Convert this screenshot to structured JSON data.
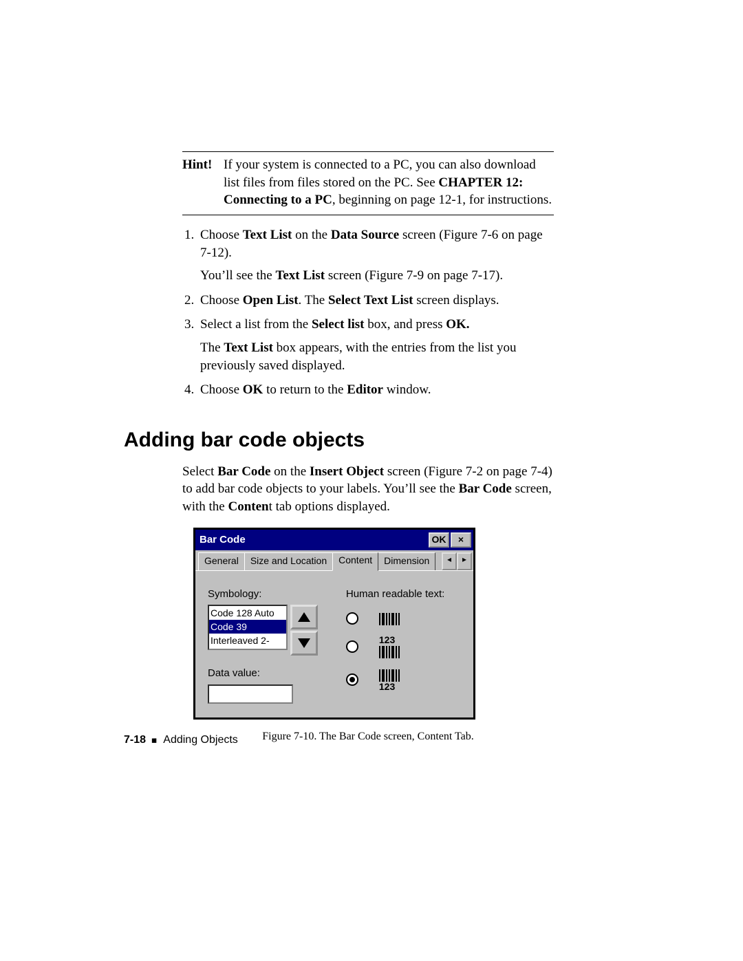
{
  "hint": {
    "label": "Hint!",
    "text_pre": "If your system is connected to a PC, you can also download list files from files stored on the PC. See ",
    "bold1": "CHAPTER 12: Connecting to a PC",
    "text_post": ", beginning on page 12-1, for instructions."
  },
  "steps": {
    "s1a": "Choose ",
    "s1b": "Text List",
    "s1c": " on the ",
    "s1d": "Data Source",
    "s1e": " screen (Figure 7-6 on page 7-12).",
    "s1p2a": "You’ll see the ",
    "s1p2b": "Text List",
    "s1p2c": " screen (Figure 7-9 on page 7-17).",
    "s2a": "Choose ",
    "s2b": "Open List",
    "s2c": ". The ",
    "s2d": "Select Text List",
    "s2e": " screen displays.",
    "s3a": "Select a list from the ",
    "s3b": "Select list",
    "s3c": " box, and press ",
    "s3d": "OK.",
    "s3p2a": "The ",
    "s3p2b": "Text List",
    "s3p2c": " box appears, with the entries from the list you previously saved displayed.",
    "s4a": "Choose ",
    "s4b": "OK",
    "s4c": " to return to the ",
    "s4d": "Editor",
    "s4e": " window."
  },
  "section_heading": "Adding bar code objects",
  "intro": {
    "a": "Select ",
    "b": "Bar Code",
    "c": " on the ",
    "d": "Insert Object",
    "e": " screen (Figure 7-2 on page 7-4) to add bar code objects to your labels. You’ll see the ",
    "f": "Bar Code",
    "g": " screen, with the ",
    "h": "Conten",
    "i": "t tab options displayed."
  },
  "dialog": {
    "title": "Bar Code",
    "ok": "OK",
    "close": "×",
    "tabs": {
      "general": "General",
      "size": "Size and Location",
      "content": "Content",
      "dimension": "Dimension"
    },
    "symbology_label": "Symbology:",
    "symbology_items": [
      "Code 128 Auto",
      "Code 39",
      "Interleaved 2-"
    ],
    "data_value_label": "Data value:",
    "hrt_label": "Human readable text:",
    "hrt_number": "123"
  },
  "figure_caption": "Figure 7-10. The Bar Code screen, Content Tab.",
  "footer": {
    "page": "7-18",
    "section": "Adding Objects"
  }
}
